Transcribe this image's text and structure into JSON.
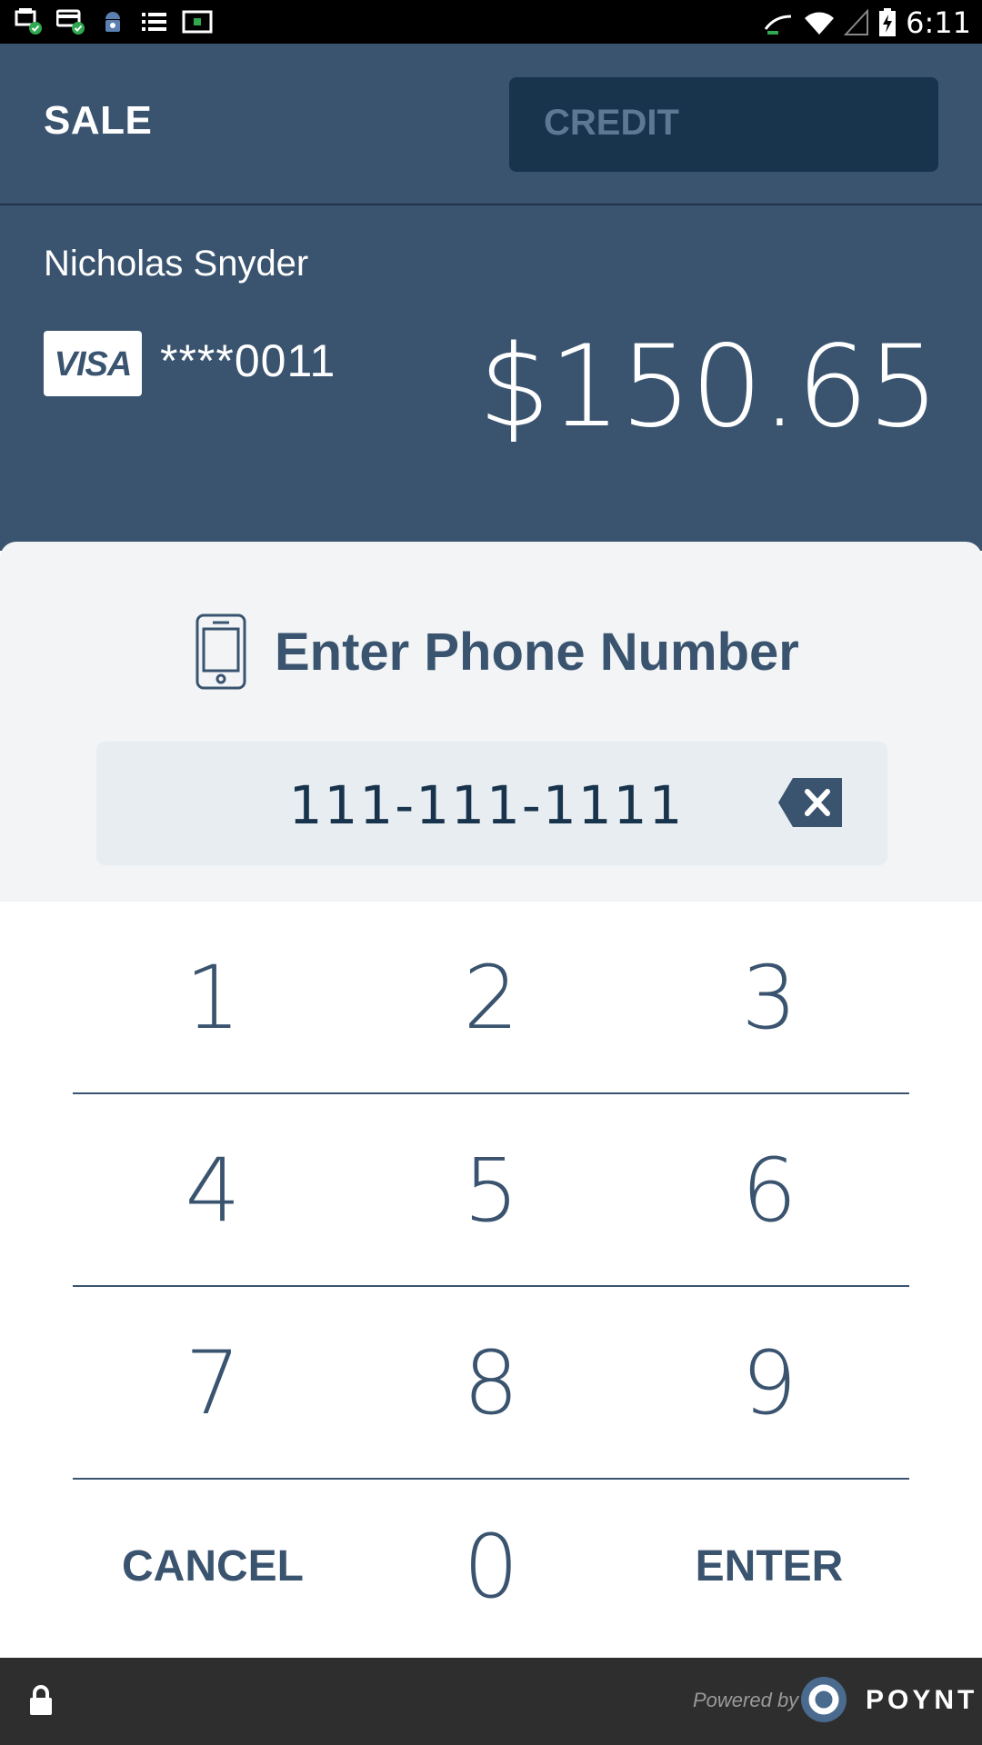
{
  "status_bar": {
    "time": "6:11",
    "left_icons": [
      "print-ok-icon",
      "card-ok-icon",
      "android-icon",
      "list-icon",
      "screen-icon"
    ],
    "right_icons": [
      "cast-icon",
      "wifi-icon",
      "signal-icon",
      "battery-charging-icon"
    ]
  },
  "header": {
    "title": "SALE",
    "payment_type": "CREDIT"
  },
  "customer": {
    "name": "Nicholas Snyder",
    "card_brand": "VISA",
    "card_number": "****0011",
    "amount": "$150.65"
  },
  "phone_entry": {
    "title": "Enter Phone Number",
    "value": "111-111-1111"
  },
  "keypad": {
    "rows": [
      [
        "1",
        "2",
        "3"
      ],
      [
        "4",
        "5",
        "6"
      ],
      [
        "7",
        "8",
        "9"
      ]
    ],
    "cancel_label": "CANCEL",
    "zero_label": "0",
    "enter_label": "ENTER"
  },
  "footer": {
    "powered_by": "Powered by",
    "brand": "POYNT"
  },
  "colors": {
    "header_bg": "#3a546f",
    "credit_bg": "#17344c",
    "panel_bg": "#f2f4f6",
    "input_bg": "#e8edf1",
    "text_accent": "#3a546f",
    "footer_bg": "#2e2e2e"
  }
}
